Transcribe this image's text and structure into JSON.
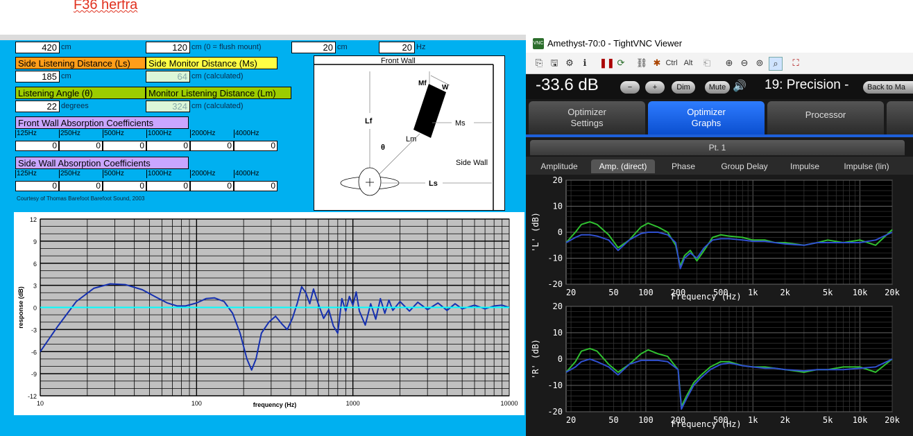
{
  "caption": "F36 herfra",
  "sheet": {
    "top_row": [
      {
        "value": "420",
        "unit": "cm"
      },
      {
        "value": "120",
        "unit": "cm  (0 = flush mount)"
      },
      {
        "value": "20",
        "unit": "cm"
      },
      {
        "value": "20",
        "unit": "Hz"
      }
    ],
    "side_listening_label": "Side Listening Distance (Ls)",
    "side_listening_value": "185",
    "side_listening_unit": "cm",
    "side_monitor_label": "Side Monitor Distance (Ms)",
    "side_monitor_value": "64",
    "side_monitor_unit": "cm  (calculated)",
    "listening_angle_label": "Listening Angle (θ)",
    "listening_angle_value": "22",
    "listening_angle_unit": "degrees",
    "monitor_listening_label": "Monitor Listening Distance (Lm)",
    "monitor_listening_value": "324",
    "monitor_listening_unit": "cm  (calculated)",
    "front_wall_label": "Front Wall Absorption Coefficients",
    "side_wall_label": "Side Wall Absorption Coefficients",
    "bands": [
      "125Hz",
      "250Hz",
      "500Hz",
      "1000Hz",
      "2000Hz",
      "4000Hz"
    ],
    "front_values": [
      "0",
      "0",
      "0",
      "0",
      "0",
      "0"
    ],
    "side_values": [
      "0",
      "0",
      "0",
      "0",
      "0",
      "0"
    ],
    "courtesy": "Courtesy of Thomas Barefoot        Barefoot Sound, 2003"
  },
  "diagram": {
    "front_wall": "Front Wall",
    "side_wall": "Side Wall",
    "lf": "Lf",
    "mf": "Mf",
    "w": "W",
    "ms": "Ms",
    "lm": "Lm",
    "theta": "θ",
    "ls": "Ls"
  },
  "chart_data": [
    {
      "type": "line",
      "title": "",
      "xlabel": "frequency (Hz)",
      "ylabel": "response (dB)",
      "xscale": "log",
      "xlim": [
        10,
        10000
      ],
      "ylim": [
        -12,
        12
      ],
      "xticks": [
        "10",
        "100",
        "1000",
        "10000"
      ],
      "yticks": [
        "12",
        "9",
        "6",
        "3",
        "0",
        "-3",
        "-6",
        "-9",
        "-12"
      ],
      "series": [
        {
          "color": "#1530b0",
          "x": [
            10,
            13,
            17,
            22,
            28,
            35,
            45,
            55,
            65,
            75,
            85,
            100,
            115,
            130,
            150,
            170,
            190,
            210,
            225,
            240,
            260,
            290,
            320,
            350,
            380,
            410,
            440,
            470,
            500,
            530,
            560,
            600,
            650,
            700,
            750,
            800,
            850,
            900,
            950,
            1000,
            1050,
            1100,
            1200,
            1300,
            1400,
            1500,
            1600,
            1700,
            1800,
            2000,
            2300,
            2600,
            3000,
            3500,
            4000,
            4500,
            5000,
            6000,
            7000,
            8000,
            9000,
            10000
          ],
          "y": [
            -6,
            -2.5,
            0.8,
            2.6,
            3.2,
            3.1,
            2.4,
            1.4,
            0.6,
            0.2,
            0.2,
            0.6,
            1.2,
            1.3,
            0.8,
            -0.8,
            -3.5,
            -7,
            -8.5,
            -7,
            -3.5,
            -2,
            -1.2,
            -2.2,
            -3,
            -1.5,
            0.5,
            2.8,
            2,
            0.5,
            2.5,
            0.5,
            -1.5,
            -0.3,
            -2.5,
            -3.5,
            1.2,
            -0.5,
            1.5,
            0.3,
            2.1,
            -0.5,
            -2.4,
            0.5,
            -1.6,
            1.2,
            -0.8,
            1.0,
            -0.4,
            0.8,
            -0.5,
            0.7,
            -0.3,
            0.6,
            -0.4,
            0.5,
            -0.2,
            0.3,
            -0.2,
            0.2,
            0.3,
            0
          ]
        },
        {
          "color": "#00ffff",
          "x": [
            10,
            10000
          ],
          "y": [
            0,
            0
          ]
        }
      ]
    },
    {
      "type": "line",
      "title": "",
      "xlabel": "Frequency (Hz)",
      "ylabel": "'L' (dB)",
      "xscale": "log",
      "xlim": [
        18,
        20000
      ],
      "ylim": [
        -20,
        20
      ],
      "xticks": [
        "20",
        "50",
        "100",
        "200",
        "500",
        "1k",
        "2k",
        "5k",
        "10k",
        "20k"
      ],
      "yticks": [
        "20",
        "10",
        "0",
        "-10",
        "-20"
      ],
      "series": [
        {
          "color": "#30c030",
          "x": [
            18,
            22,
            25,
            30,
            35,
            45,
            55,
            70,
            90,
            105,
            130,
            160,
            190,
            210,
            230,
            260,
            300,
            350,
            420,
            500,
            600,
            800,
            1000,
            1300,
            1600,
            2000,
            3000,
            4000,
            5000,
            7000,
            10000,
            14000,
            20000
          ],
          "y": [
            -4,
            0,
            3,
            4,
            3,
            -1,
            -6,
            -3,
            2,
            3.5,
            2,
            0,
            -5,
            -13,
            -9,
            -7,
            -11,
            -7,
            -2,
            -1,
            -1.5,
            -2,
            -3,
            -3,
            -4,
            -4,
            -5,
            -4,
            -3,
            -4,
            -3,
            -5,
            1
          ]
        },
        {
          "color": "#3050d0",
          "x": [
            18,
            22,
            25,
            30,
            35,
            45,
            55,
            70,
            90,
            105,
            130,
            160,
            190,
            210,
            230,
            260,
            300,
            350,
            420,
            500,
            600,
            800,
            1000,
            1300,
            1600,
            2000,
            3000,
            4000,
            5000,
            7000,
            10000,
            14000,
            20000
          ],
          "y": [
            -4,
            -2,
            -1,
            -1,
            -1.5,
            -3,
            -7,
            -3,
            -0.5,
            0,
            0,
            -1,
            -4,
            -14,
            -10,
            -8,
            -10,
            -6,
            -3,
            -2.5,
            -2.5,
            -3,
            -3.5,
            -3.5,
            -4,
            -4.5,
            -5,
            -4,
            -4,
            -4,
            -4,
            -3,
            0
          ]
        }
      ]
    },
    {
      "type": "line",
      "title": "",
      "xlabel": "Frequency (Hz)",
      "ylabel": "'R' (dB)",
      "xscale": "log",
      "xlim": [
        18,
        20000
      ],
      "ylim": [
        -20,
        20
      ],
      "xticks": [
        "20",
        "50",
        "100",
        "200",
        "500",
        "1k",
        "2k",
        "5k",
        "10k",
        "20k"
      ],
      "yticks": [
        "20",
        "10",
        "0",
        "-10",
        "-20"
      ],
      "series": [
        {
          "color": "#30c030",
          "x": [
            18,
            22,
            25,
            30,
            35,
            45,
            55,
            70,
            90,
            105,
            130,
            160,
            200,
            215,
            240,
            280,
            330,
            400,
            500,
            600,
            800,
            1000,
            1300,
            1600,
            2000,
            3000,
            4000,
            5000,
            7000,
            10000,
            14000,
            20000
          ],
          "y": [
            -5,
            -1,
            3,
            4,
            3,
            -2,
            -5,
            -2,
            2,
            3.5,
            2,
            1,
            -4,
            -18,
            -14,
            -9,
            -6,
            -3,
            -1,
            -1,
            -2.5,
            -3,
            -3,
            -3.5,
            -4,
            -5,
            -4,
            -4,
            -3,
            -3,
            -5,
            0
          ]
        },
        {
          "color": "#3050d0",
          "x": [
            18,
            22,
            25,
            30,
            35,
            45,
            55,
            70,
            90,
            105,
            130,
            160,
            200,
            215,
            240,
            280,
            330,
            400,
            500,
            600,
            800,
            1000,
            1300,
            1600,
            2000,
            3000,
            4000,
            5000,
            7000,
            10000,
            14000,
            20000
          ],
          "y": [
            -5,
            -3,
            -1,
            0,
            -1,
            -3,
            -6,
            -2,
            -0.5,
            -0.5,
            -0.5,
            -1,
            -4,
            -19,
            -15,
            -10,
            -7,
            -4,
            -2,
            -1.5,
            -2.5,
            -3,
            -3.5,
            -3.5,
            -4,
            -4.5,
            -4,
            -4,
            -4,
            -3.5,
            -3,
            0
          ]
        }
      ]
    }
  ],
  "vnc": {
    "window_title": "Amethyst-70:0 - TightVNC Viewer",
    "volume": "-33.6 dB",
    "minus": "−",
    "plus": "+",
    "dim": "Dim",
    "mute": "Mute",
    "preset": "19: Precision -",
    "back": "Back to Ma",
    "tabs": [
      "Optimizer\nSettings",
      "Optimizer\nGraphs",
      "Processor"
    ],
    "point_tab": "Pt. 1",
    "sub_tabs": [
      "Amplitude",
      "Amp. (direct)",
      "Phase",
      "Group Delay",
      "Impulse",
      "Impulse (lin)"
    ],
    "toolbar_ctrl": "Ctrl",
    "toolbar_alt": "Alt",
    "colors": {
      "accent": "#1e5fd9",
      "bg": "#1a1a1a"
    }
  }
}
